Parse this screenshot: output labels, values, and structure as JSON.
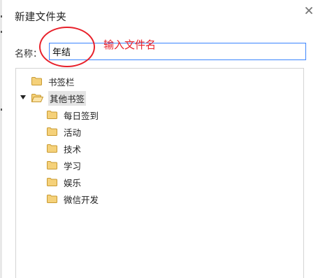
{
  "dialog": {
    "title": "新建文件夹",
    "close_glyph": "×"
  },
  "name_field": {
    "label": "名称：",
    "value": "年结"
  },
  "annotation": {
    "text": "输入文件名",
    "color": "#e8202a"
  },
  "tree": {
    "items": [
      {
        "label": "书签栏",
        "level": 0,
        "expanded": false,
        "selected": false
      },
      {
        "label": "其他书签",
        "level": 0,
        "expanded": true,
        "selected": true
      },
      {
        "label": "每日签到",
        "level": 1,
        "expanded": false,
        "selected": false
      },
      {
        "label": "活动",
        "level": 1,
        "expanded": false,
        "selected": false
      },
      {
        "label": "技术",
        "level": 1,
        "expanded": false,
        "selected": false
      },
      {
        "label": "学习",
        "level": 1,
        "expanded": false,
        "selected": false
      },
      {
        "label": "娱乐",
        "level": 1,
        "expanded": false,
        "selected": false
      },
      {
        "label": "微信开发",
        "level": 1,
        "expanded": false,
        "selected": false
      }
    ]
  },
  "colors": {
    "folder_fill": "#f5d17a",
    "folder_stroke": "#c89a32",
    "input_focus_border": "#4d90fe",
    "annotation": "#e8202a"
  }
}
